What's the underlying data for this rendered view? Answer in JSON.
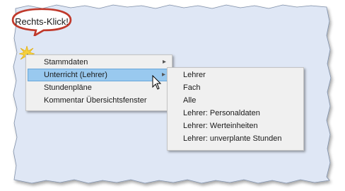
{
  "callout": {
    "text": "Rechts-Klick!"
  },
  "context_menu": {
    "items": [
      {
        "label": "Stammdaten",
        "submenu": true
      },
      {
        "label": "Unterricht (Lehrer)",
        "submenu": true,
        "highlighted": true
      },
      {
        "label": "Stundenpläne",
        "submenu": false
      },
      {
        "label": "Kommentar Übersichtsfenster",
        "submenu": false
      }
    ]
  },
  "submenu": {
    "items": [
      {
        "label": "Lehrer"
      },
      {
        "label": "Fach"
      },
      {
        "label": "Alle"
      },
      {
        "label": "Lehrer: Personaldaten"
      },
      {
        "label": "Lehrer:  Werteinheiten"
      },
      {
        "label": "Lehrer: unverplante Stunden"
      }
    ]
  },
  "icons": {
    "arrow": "▸",
    "pointer": "mouse-pointer-icon",
    "burst": "click-starburst-icon"
  },
  "colors": {
    "panel": "#dfe7f5",
    "highlight": "#99c9ef",
    "callout_border": "#c0392b"
  }
}
